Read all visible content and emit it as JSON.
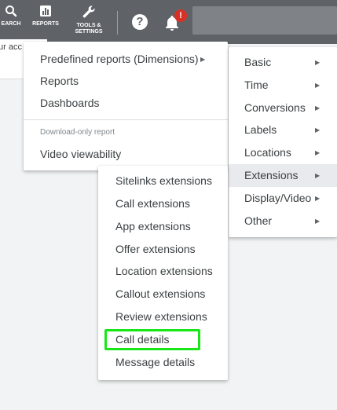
{
  "topbar": {
    "search_label": "EARCH",
    "reports_label": "REPORTS",
    "tools_label_line1": "TOOLS &",
    "tools_label_line2": "SETTINGS",
    "help_glyph": "?",
    "notification_badge": "!",
    "icons": {
      "search": "search-icon",
      "reports": "reports-icon",
      "tools": "wrench-icon",
      "help": "help-icon",
      "notifications": "bell-icon"
    },
    "colors": {
      "bar": "#5f6368",
      "badge": "#d93025"
    }
  },
  "searchbar": {
    "text": "ur acc"
  },
  "reports_menu": {
    "items": [
      {
        "label": "Predefined reports (Dimensions)"
      },
      {
        "label": "Reports"
      },
      {
        "label": "Dashboards"
      }
    ],
    "section_label": "Download-only report",
    "download_items": [
      {
        "label": "Video viewability"
      }
    ]
  },
  "dimensions_menu": {
    "items": [
      {
        "label": "Basic"
      },
      {
        "label": "Time"
      },
      {
        "label": "Conversions"
      },
      {
        "label": "Labels"
      },
      {
        "label": "Locations"
      },
      {
        "label": "Extensions"
      },
      {
        "label": "Display/Video"
      },
      {
        "label": "Other"
      }
    ],
    "active_item": "Extensions"
  },
  "extensions_menu": {
    "items": [
      {
        "label": "Sitelinks extensions"
      },
      {
        "label": "Call extensions"
      },
      {
        "label": "App extensions"
      },
      {
        "label": "Offer extensions"
      },
      {
        "label": "Location extensions"
      },
      {
        "label": "Callout extensions"
      },
      {
        "label": "Review extensions"
      },
      {
        "label": "Call details"
      },
      {
        "label": "Message details"
      }
    ],
    "highlighted_item": "Call details",
    "highlight_color": "#19e619"
  }
}
